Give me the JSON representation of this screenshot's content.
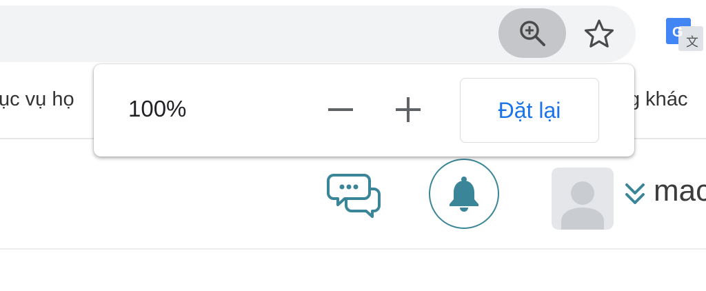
{
  "toolbar": {
    "zoom_icon": "zoom-in-magnifier-icon",
    "bookmark_icon": "star-icon",
    "translate_icon": "google-translate-icon"
  },
  "bookmarks_bar": {
    "left_partial_text": "ục vụ họ",
    "right_partial_text": "g khác"
  },
  "zoom_popup": {
    "level": "100%",
    "decrease_icon": "minus-icon",
    "increase_icon": "plus-icon",
    "reset_label": "Đặt lại"
  },
  "header": {
    "chat_icon": "chat-bubbles-icon",
    "notification_icon": "bell-icon",
    "avatar_icon": "user-avatar-icon",
    "menu_icon": "double-chevron-down-icon",
    "username_partial": "mac"
  },
  "colors": {
    "reset_text": "#1a73e8",
    "teal_accent": "#3a8597",
    "omnibox_bg": "#f1f3f4",
    "zoom_button_bg": "#c4c6c9"
  }
}
